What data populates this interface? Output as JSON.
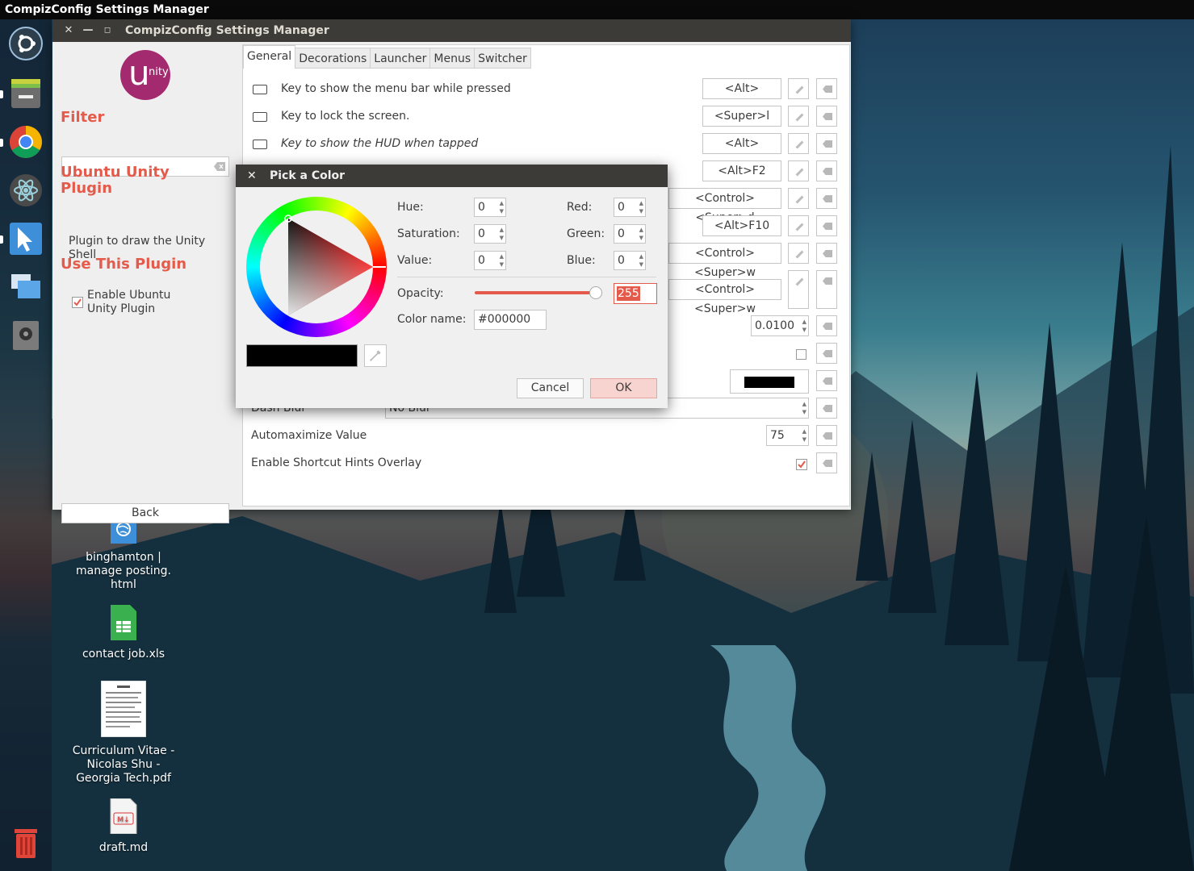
{
  "topbar": {
    "title": "CompizConfig Settings Manager"
  },
  "desktop_icons": [
    {
      "label": "binghamton | manage posting. html"
    },
    {
      "label": "contact job.xls"
    },
    {
      "label": "Curriculum Vitae - Nicolas Shu - Georgia Tech.pdf"
    },
    {
      "label": "draft.md",
      "badge": "M↓"
    }
  ],
  "main_window": {
    "title": "CompizConfig Settings Manager",
    "logo_text": "u",
    "logo_suffix": "nity",
    "filter_heading": "Filter",
    "filter_value": "",
    "plugin_heading_1": "Ubuntu Unity",
    "plugin_heading_2": "Plugin",
    "plugin_description": "Plugin to draw the Unity Shell",
    "use_heading": "Use This Plugin",
    "enable_label": "Enable Ubuntu Unity Plugin",
    "enable_checked": true,
    "back_label": "Back",
    "tabs": [
      "General",
      "Decorations",
      "Launcher",
      "Menus",
      "Switcher"
    ],
    "active_tab": "General",
    "rows": [
      {
        "label": "Key to show the menu bar while pressed",
        "key": "<Alt>"
      },
      {
        "label": "Key to lock the screen.",
        "key": "<Super>l"
      },
      {
        "label": "Key to show the HUD when tapped",
        "key": "<Alt>"
      },
      {
        "key": "<Alt>F2"
      },
      {
        "key": "<Control><Super>d"
      },
      {
        "key": "<Alt>F10"
      },
      {
        "key": "<Control><Super>w"
      },
      {
        "key": "<Control><Super>w"
      }
    ],
    "numeric_value": "0.0100",
    "dash_blur_label": "Dash Blur",
    "dash_blur_value": "No Blur",
    "automaximize_label": "Automaximize Value",
    "automaximize_value": "75",
    "shortcut_hints_label": "Enable Shortcut Hints Overlay",
    "shortcut_hints_checked": true
  },
  "color_dialog": {
    "title": "Pick a Color",
    "hue_label": "Hue:",
    "hue": "0",
    "saturation_label": "Saturation:",
    "saturation": "0",
    "value_label": "Value:",
    "value": "0",
    "red_label": "Red:",
    "red": "0",
    "green_label": "Green:",
    "green": "0",
    "blue_label": "Blue:",
    "blue": "0",
    "opacity_label": "Opacity:",
    "opacity": "255",
    "opacity_fraction": 1.0,
    "color_name_label": "Color name:",
    "color_name": "#000000",
    "cancel_label": "Cancel",
    "ok_label": "OK",
    "current_color": "#000000"
  },
  "colors": {
    "accent": "#e45a4b",
    "titlebar": "#3c3b37",
    "unity_logo": "#a42a70"
  }
}
